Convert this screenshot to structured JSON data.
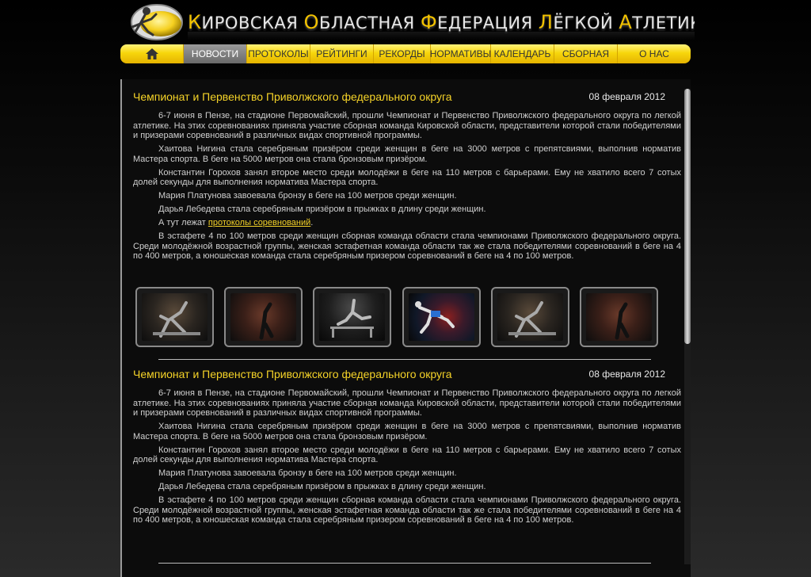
{
  "header": {
    "title_words": [
      {
        "cap": "К",
        "rest": "ИРОВСКАЯ"
      },
      {
        "cap": "О",
        "rest": "БЛАСТНАЯ"
      },
      {
        "cap": "Ф",
        "rest": "ЕДЕРАЦИЯ"
      },
      {
        "cap": "Л",
        "rest": "ЁГКОЙ"
      },
      {
        "cap": "А",
        "rest": "ТЛЕТИКИ"
      }
    ]
  },
  "nav": {
    "home_icon": "home-icon",
    "items": [
      "НОВОСТИ",
      "ПРОТОКОЛЫ",
      "РЕЙТИНГИ",
      "РЕКОРДЫ",
      "НОРМАТИВЫ",
      "КАЛЕНДАРЬ",
      "СБОРНАЯ",
      "О НАС"
    ],
    "active": "НОВОСТИ"
  },
  "articles": [
    {
      "title": "Чемпионат и Первенство Приволжского федерального округа",
      "date": "08 февраля 2012",
      "p1": "6-7 июня в Пензе, на стадионе Первомайский, прошли Чемпионат и Первенство Приволжского федерального округа по легкой атлетике. На этих соревнованиях приняла участие сборная команда Кировской области, представители которой стали победителями и призерами соревнований в различных видах спортивной программы.",
      "p2": "Хаитова Нигина стала серебряным призёром среди женщин в беге на 3000 метров с препятсвиями, выполнив норматив Мастера спорта. В беге на 5000 метров она стала бронзовым призёром.",
      "p3": "Константин Горохов занял второе место среди молодёжи в беге на 110 метров с барьерами. Ему не хватило всего 7 сотых долей секунды для выполнения норматива Мастера спорта.",
      "p4": "Мария Платунова завоевала бронзу в беге на 100 метров среди женщин.",
      "p5": "Дарья Лебедева стала серебряным призёром в прыжках в длину среди женщин.",
      "p6_prefix": "А тут лежат ",
      "p6_link": "протоколы соревнований",
      "p6_suffix": ".",
      "p7": "В эстафете 4 по 100 метров среди женщин сборная команда области стала чемпионами Приволжского федерального округа. Среди молодёжной возрастной группы, женская эстафетная команда области так же стала победителями соревнований в беге на 4 по 400 метров, а юношеская команда стала серебряным призером соревнований в беге на 4 по 100 метров.",
      "gallery_count": 6
    },
    {
      "title": "Чемпионат и Первенство Приволжского федерального округа",
      "date": "08 февраля 2012",
      "p1": "6-7 июня в Пензе, на стадионе Первомайский, прошли Чемпионат и Первенство Приволжского федерального округа по легкой атлетике. На этих соревнованиях приняла участие сборная команда Кировской области, представители которой стали победителями и призерами соревнований в различных видах спортивной программы.",
      "p2": "Хаитова Нигина стала серебряным призёром среди женщин в беге на 3000 метров с препятсвиями, выполнив норматив Мастера спорта. В беге на 5000 метров она стала бронзовым призёром.",
      "p3": "Константин Горохов занял второе место среди молодёжи в беге на 110 метров с барьерами. Ему не хватило всего 7 сотых долей секунды для выполнения норматива Мастера спорта.",
      "p4": "Мария Платунова завоевала бронзу в беге на 100 метров среди женщин.",
      "p5": "Дарья Лебедева стала серебряным призёром в прыжках в длину среди женщин.",
      "p7": "В эстафете 4 по 100 метров среди женщин сборная команда области стала чемпионами Приволжского федерального округа. Среди молодёжной возрастной группы, женская эстафетная команда области так же стала победителями соревнований в беге на 4 по 400 метров, а юношеская команда стала серебряным призером соревнований в беге на 4 по 100 метров."
    }
  ],
  "colors": {
    "accent_yellow": "#f5d328",
    "nav_yellow": "#f7d60c",
    "nav_active": "#7a7a7a",
    "background": "#0c0c0c"
  }
}
